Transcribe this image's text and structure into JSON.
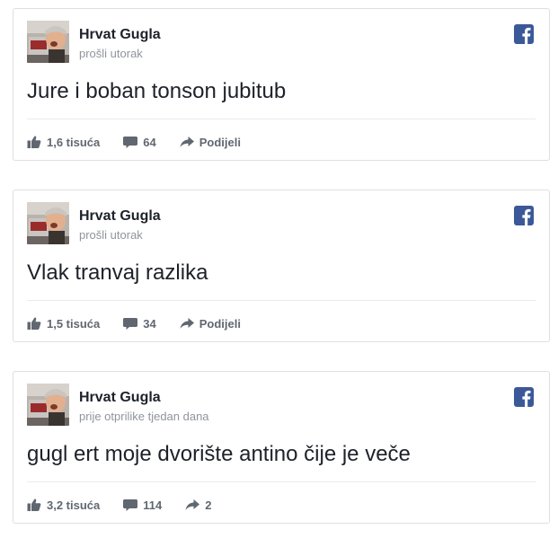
{
  "colors": {
    "facebook_blue": "#3b5998",
    "action_gray": "#606770",
    "meta_gray": "#90949c"
  },
  "posts": [
    {
      "author": "Hrvat Gugla",
      "time": "prošli utorak",
      "text": "Jure i boban tonson jubitub",
      "likes": "1,6 tisuća",
      "comments": "64",
      "share": "Podijeli"
    },
    {
      "author": "Hrvat Gugla",
      "time": "prošli utorak",
      "text": "Vlak tranvaj razlika",
      "likes": "1,5 tisuća",
      "comments": "34",
      "share": "Podijeli"
    },
    {
      "author": "Hrvat Gugla",
      "time": "prije otprilike tjedan dana",
      "text": "gugl ert moje dvorište antino čije je veče",
      "likes": "3,2 tisuća",
      "comments": "114",
      "share": "2"
    }
  ]
}
